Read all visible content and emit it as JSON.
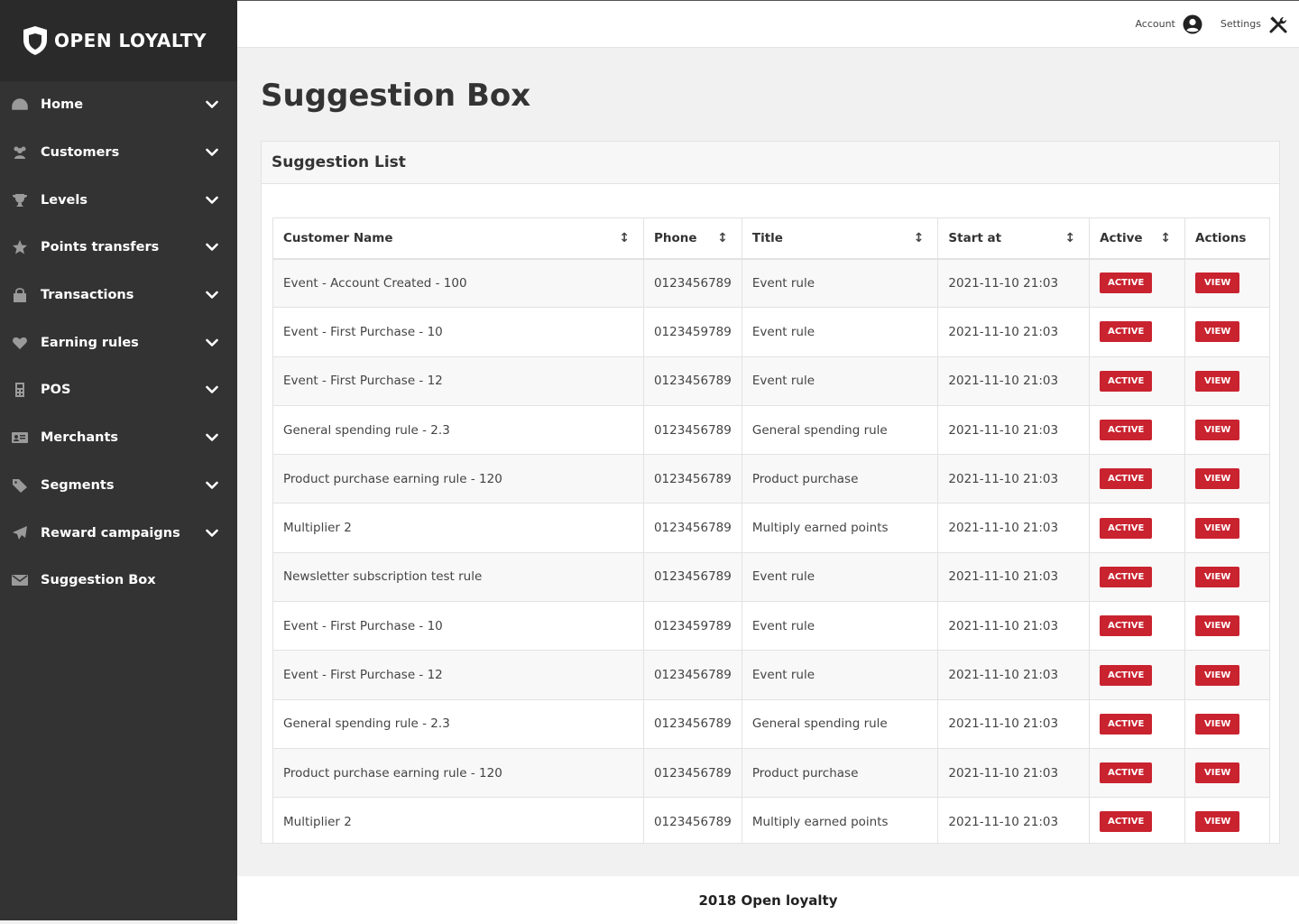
{
  "brand": {
    "name": "OPEN LOYALTY"
  },
  "topbar": {
    "account_label": "Account",
    "settings_label": "Settings"
  },
  "sidebar": {
    "items": [
      {
        "label": "Home",
        "icon": "dashboard-icon",
        "expandable": true
      },
      {
        "label": "Customers",
        "icon": "users-icon",
        "expandable": true
      },
      {
        "label": "Levels",
        "icon": "trophy-icon",
        "expandable": true
      },
      {
        "label": "Points transfers",
        "icon": "star-icon",
        "expandable": true
      },
      {
        "label": "Transactions",
        "icon": "shopping-bag-icon",
        "expandable": true
      },
      {
        "label": "Earning rules",
        "icon": "heart-icon",
        "expandable": true
      },
      {
        "label": "POS",
        "icon": "pos-terminal-icon",
        "expandable": true
      },
      {
        "label": "Merchants",
        "icon": "id-card-icon",
        "expandable": true
      },
      {
        "label": "Segments",
        "icon": "tags-icon",
        "expandable": true
      },
      {
        "label": "Reward campaigns",
        "icon": "paper-plane-icon",
        "expandable": true
      },
      {
        "label": "Suggestion Box",
        "icon": "envelope-icon",
        "expandable": false
      }
    ]
  },
  "main": {
    "title": "Suggestion Box",
    "panel_title": "Suggestion List",
    "columns": [
      {
        "label": "Customer Name",
        "sortable": true
      },
      {
        "label": "Phone",
        "sortable": true
      },
      {
        "label": "Title",
        "sortable": true
      },
      {
        "label": "Start at",
        "sortable": true
      },
      {
        "label": "Active",
        "sortable": true
      },
      {
        "label": "Actions",
        "sortable": false
      }
    ],
    "rows": [
      {
        "customer": "Event - Account Created - 100",
        "phone": "0123456789",
        "title": "Event rule",
        "start": "2021-11-10 21:03",
        "active": "ACTIVE",
        "action": "VIEW"
      },
      {
        "customer": "Event - First Purchase - 10",
        "phone": "0123459789",
        "title": "Event rule",
        "start": "2021-11-10 21:03",
        "active": "ACTIVE",
        "action": "VIEW"
      },
      {
        "customer": "Event - First Purchase - 12",
        "phone": "0123456789",
        "title": "Event rule",
        "start": "2021-11-10 21:03",
        "active": "ACTIVE",
        "action": "VIEW"
      },
      {
        "customer": "General spending rule - 2.3",
        "phone": "0123456789",
        "title": "General spending rule",
        "start": "2021-11-10 21:03",
        "active": "ACTIVE",
        "action": "VIEW"
      },
      {
        "customer": "Product purchase earning rule - 120",
        "phone": "0123456789",
        "title": "Product purchase",
        "start": "2021-11-10 21:03",
        "active": "ACTIVE",
        "action": "VIEW"
      },
      {
        "customer": "Multiplier 2",
        "phone": "0123456789",
        "title": "Multiply earned points",
        "start": "2021-11-10 21:03",
        "active": "ACTIVE",
        "action": "VIEW"
      },
      {
        "customer": "Newsletter subscription test rule",
        "phone": "0123456789",
        "title": "Event rule",
        "start": "2021-11-10 21:03",
        "active": "ACTIVE",
        "action": "VIEW"
      },
      {
        "customer": "Event - First Purchase - 10",
        "phone": "0123459789",
        "title": "Event rule",
        "start": "2021-11-10 21:03",
        "active": "ACTIVE",
        "action": "VIEW"
      },
      {
        "customer": "Event - First Purchase - 12",
        "phone": "0123456789",
        "title": "Event rule",
        "start": "2021-11-10 21:03",
        "active": "ACTIVE",
        "action": "VIEW"
      },
      {
        "customer": "General spending rule - 2.3",
        "phone": "0123456789",
        "title": "General spending rule",
        "start": "2021-11-10 21:03",
        "active": "ACTIVE",
        "action": "VIEW"
      },
      {
        "customer": "Product purchase earning rule - 120",
        "phone": "0123456789",
        "title": "Product purchase",
        "start": "2021-11-10 21:03",
        "active": "ACTIVE",
        "action": "VIEW"
      },
      {
        "customer": "Multiplier 2",
        "phone": "0123456789",
        "title": "Multiply earned points",
        "start": "2021-11-10 21:03",
        "active": "ACTIVE",
        "action": "VIEW"
      }
    ]
  },
  "footer": {
    "text": "2018 Open loyalty"
  },
  "colors": {
    "sidebar_bg": "#333333",
    "brand_bg": "#2a2a2a",
    "accent_red": "#c9232f",
    "page_bg": "#f1f1f1"
  }
}
